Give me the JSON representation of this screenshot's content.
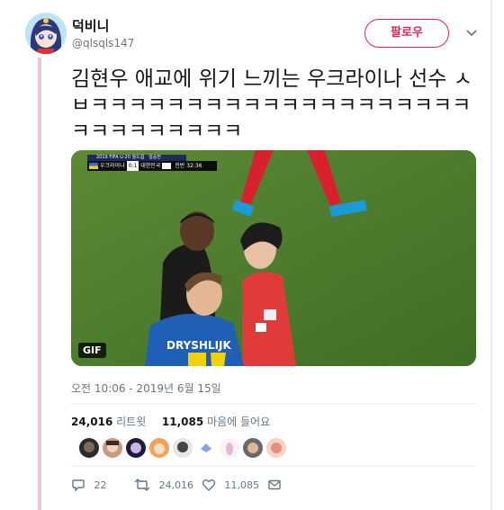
{
  "author": {
    "display_name": "덕비니",
    "handle": "@qlsqls147"
  },
  "follow_button_label": "팔로우",
  "tweet": {
    "text": "김현우 애교에 위기 느끼는 우크라이나 선수 ㅅㅂㅋㅋㅋㅋㅋㅋㅋㅋㅋㅋㅋㅋㅋㅋㅋㅋㅋㅋㅋㅋㅋㅋㅋㅋㅋㅋㅋㅋㅋ",
    "timestamp": "오전 10:06 - 2019년 6월 15일"
  },
  "media": {
    "badge": "GIF",
    "scorebox": {
      "event": "2019 FIFA U-20 월드컵",
      "goal": "일승전",
      "team_left": "우크라이나",
      "score": "0:1",
      "team_right": "대한민국",
      "clock": "전반 32:36"
    },
    "jersey_text": "DRYSHLIJK"
  },
  "stats": {
    "retweets": "24,016",
    "retweets_label": "리트윗",
    "likes": "11,085",
    "likes_label": "마음에 들어요"
  },
  "actions": {
    "replies": "22",
    "retweets": "24,016",
    "likes": "11,085"
  },
  "colors": {
    "accent": "#e0245e",
    "text_secondary": "#657786",
    "rail": "#f7c3d4"
  }
}
